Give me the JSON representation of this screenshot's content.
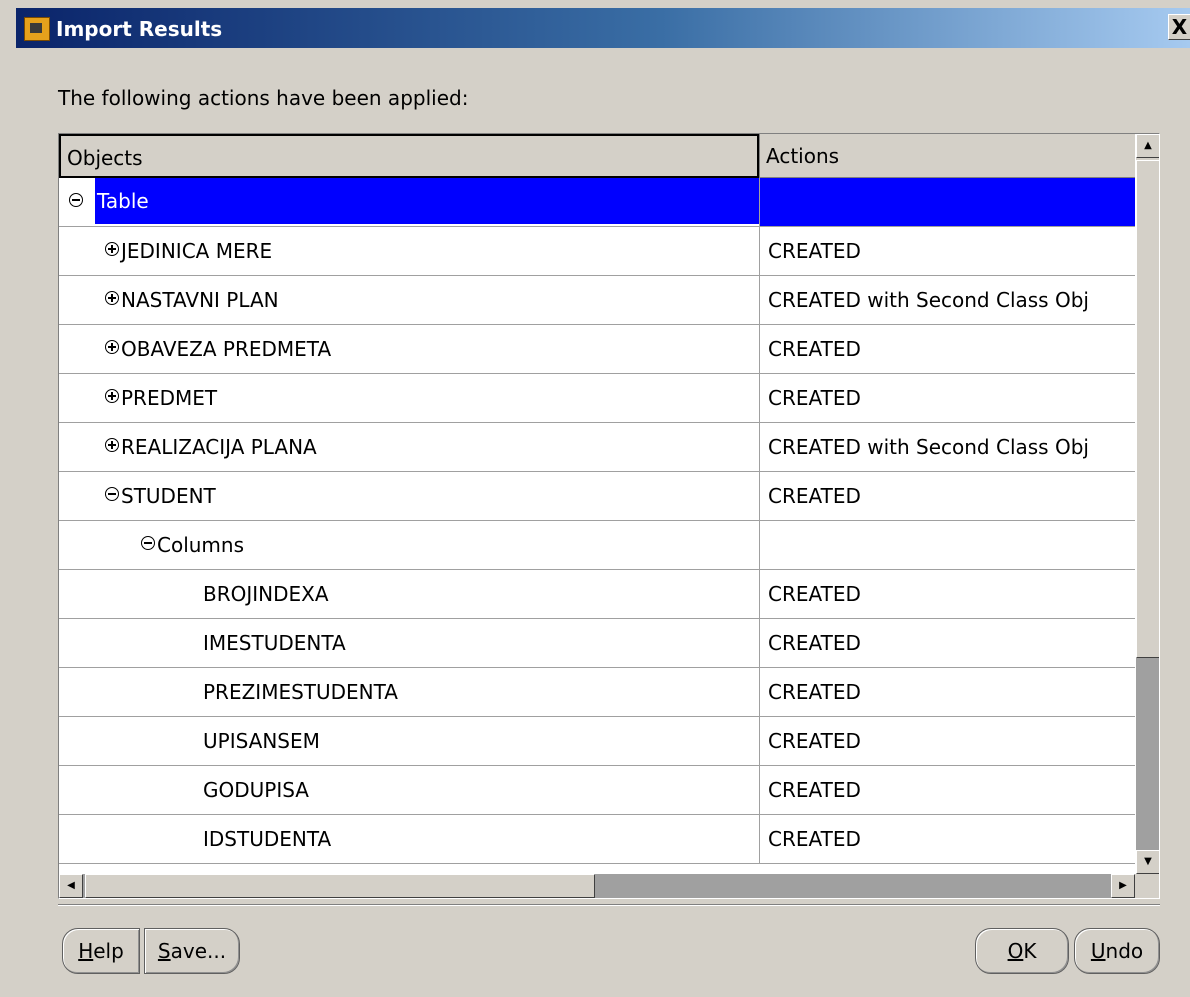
{
  "window": {
    "title": "Import Results",
    "close_label": "X"
  },
  "intro_text": "The following actions have been applied:",
  "table": {
    "headers": {
      "objects": "Objects",
      "actions": "Actions"
    },
    "rows": [
      {
        "label": "Table",
        "action": "",
        "level": 0,
        "toggle": "minus",
        "selected": true
      },
      {
        "label": "JEDINICA MERE",
        "action": "CREATED",
        "level": 1,
        "toggle": "plus"
      },
      {
        "label": "NASTAVNI PLAN",
        "action": "CREATED with Second Class Obj",
        "level": 1,
        "toggle": "plus"
      },
      {
        "label": "OBAVEZA PREDMETA",
        "action": "CREATED",
        "level": 1,
        "toggle": "plus"
      },
      {
        "label": "PREDMET",
        "action": "CREATED",
        "level": 1,
        "toggle": "plus"
      },
      {
        "label": "REALIZACIJA PLANA",
        "action": "CREATED with Second Class Obj",
        "level": 1,
        "toggle": "plus"
      },
      {
        "label": "STUDENT",
        "action": "CREATED",
        "level": 1,
        "toggle": "minus"
      },
      {
        "label": "Columns",
        "action": "",
        "level": 2,
        "toggle": "minus"
      },
      {
        "label": "BROJINDEXA",
        "action": "CREATED",
        "level": 3,
        "toggle": "none"
      },
      {
        "label": "IMESTUDENTA",
        "action": "CREATED",
        "level": 3,
        "toggle": "none"
      },
      {
        "label": "PREZIMESTUDENTA",
        "action": "CREATED",
        "level": 3,
        "toggle": "none"
      },
      {
        "label": "UPISANSEM",
        "action": "CREATED",
        "level": 3,
        "toggle": "none"
      },
      {
        "label": "GODUPISA",
        "action": "CREATED",
        "level": 3,
        "toggle": "none"
      },
      {
        "label": "IDSTUDENTA",
        "action": "CREATED",
        "level": 3,
        "toggle": "none"
      }
    ]
  },
  "buttons": {
    "help": {
      "mnemonic": "H",
      "rest": "elp"
    },
    "save": {
      "mnemonic": "S",
      "rest": "ave..."
    },
    "ok": {
      "mnemonic": "O",
      "rest": "K"
    },
    "undo": {
      "mnemonic": "U",
      "rest": "ndo"
    }
  },
  "colors": {
    "selection": "#0000ff",
    "dialog_bg": "#d4d0c8",
    "title_start": "#0a246a",
    "title_end": "#a6caf0"
  }
}
